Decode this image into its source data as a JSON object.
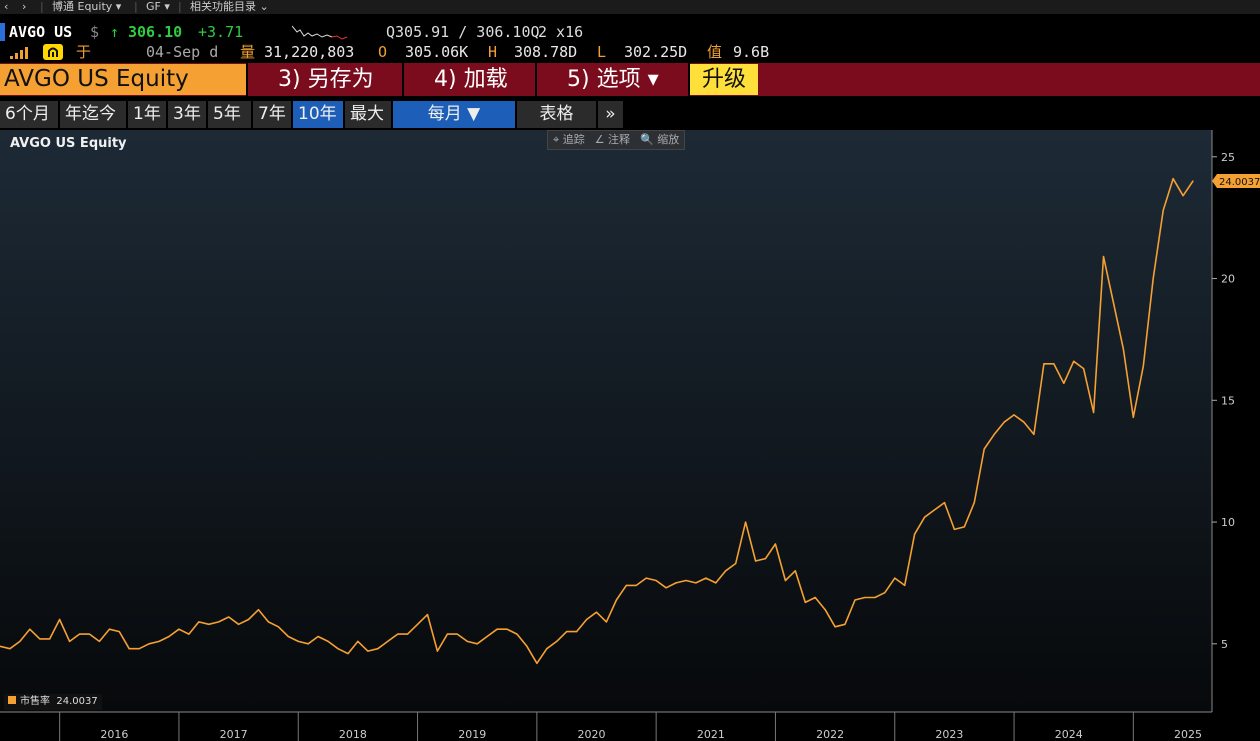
{
  "nav": {
    "back": "‹",
    "forward": "›",
    "item1": "博通 Equity ▾",
    "item2": "GF ▾",
    "item3": "相关功能目录 ⌄"
  },
  "quote": {
    "ticker": "AVGO US",
    "currency": "$",
    "arrow": "↑",
    "last": "306.10",
    "change": "+3.71",
    "bidask": "Q305.91 / 306.10Q",
    "size": "2 x16",
    "date": "04-Sep d",
    "vol_label": "量",
    "volume": "31,220,803",
    "open_label": "O",
    "open": "305.06K",
    "high_label": "H",
    "high": "308.78D",
    "low_label": "L",
    "low": "302.25D",
    "val_label": "值",
    "value": "9.6B",
    "yu": "于"
  },
  "toolbar": {
    "security": "AVGO US Equity",
    "save_as": "3) 另存为",
    "load": "4) 加载",
    "options": "5) 选项 ▾",
    "upgrade": "升级"
  },
  "ranges": {
    "r1": "6个月",
    "r2": "年迄今",
    "r3": "1年",
    "r4": "3年",
    "r5": "5年",
    "r6": "7年",
    "r7": "10年",
    "r8": "最大",
    "period": "每月 ▼",
    "table": "表格",
    "more": "»"
  },
  "tools": {
    "track": "⌖ 追踪",
    "annotate": "∠ 注释",
    "zoom": "🔍 缩放"
  },
  "colors": {
    "line": "#f5a032",
    "bg_top": "#1d2a36",
    "bg_bottom": "#07090b",
    "up": "#2ecc40",
    "toolbar": "#7a0c1e"
  },
  "chart_data": {
    "type": "line",
    "title": "AVGO US Equity",
    "series": [
      {
        "name": "市售率",
        "last_label": "24.0037",
        "values": [
          4.9,
          4.8,
          5.1,
          5.6,
          5.2,
          5.2,
          6.0,
          5.1,
          5.4,
          5.4,
          5.1,
          5.6,
          5.5,
          4.8,
          4.8,
          5.0,
          5.1,
          5.3,
          5.6,
          5.4,
          5.9,
          5.8,
          5.9,
          6.1,
          5.8,
          6.0,
          6.4,
          5.9,
          5.7,
          5.3,
          5.1,
          5.0,
          5.3,
          5.1,
          4.8,
          4.6,
          5.1,
          4.7,
          4.8,
          5.1,
          5.4,
          5.4,
          5.8,
          6.2,
          4.7,
          5.4,
          5.4,
          5.1,
          5.0,
          5.3,
          5.6,
          5.6,
          5.4,
          4.9,
          4.2,
          4.8,
          5.1,
          5.5,
          5.5,
          6.0,
          6.3,
          5.9,
          6.8,
          7.4,
          7.4,
          7.7,
          7.6,
          7.3,
          7.5,
          7.6,
          7.5,
          7.7,
          7.5,
          8.0,
          8.3,
          10.0,
          8.4,
          8.5,
          9.1,
          7.6,
          8.0,
          6.7,
          6.9,
          6.4,
          5.7,
          5.8,
          6.8,
          6.9,
          6.9,
          7.1,
          7.7,
          7.4,
          9.5,
          10.2,
          10.5,
          10.8,
          9.7,
          9.8,
          10.8,
          13.0,
          13.6,
          14.1,
          14.4,
          14.1,
          13.6,
          16.5,
          16.5,
          15.7,
          16.6,
          16.3,
          14.5,
          20.9,
          19.0,
          17.1,
          14.3,
          16.4,
          20.0,
          22.8,
          24.1,
          23.4,
          24.0037
        ]
      }
    ],
    "x_start": "2015-07",
    "x_interval": "monthly",
    "xticks": [
      "2016",
      "2017",
      "2018",
      "2019",
      "2020",
      "2021",
      "2022",
      "2023",
      "2024",
      "2025"
    ],
    "yticks": [
      5,
      10,
      15,
      20,
      25
    ],
    "ylim": [
      2.2,
      26.1
    ],
    "grid": false,
    "legend_position": "bottom-left"
  }
}
